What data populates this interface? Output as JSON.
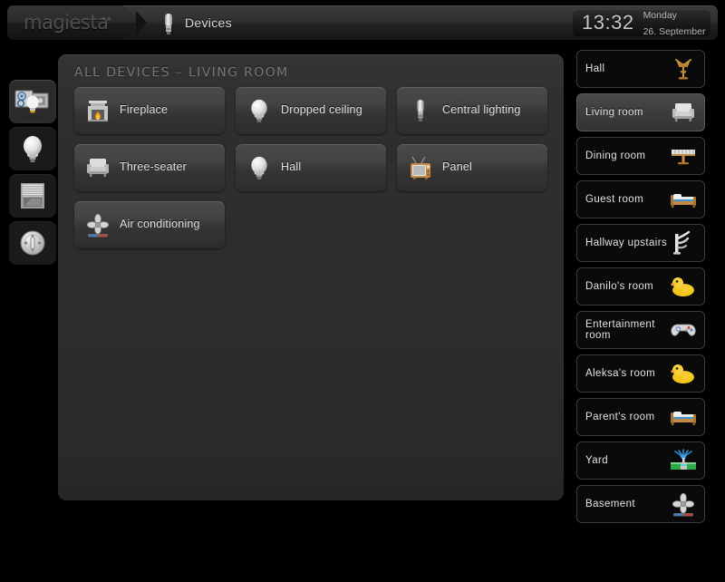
{
  "header": {
    "logo": "magiesta",
    "logo_dots": "••",
    "breadcrumb_icon": "fluorescent-bulb-icon",
    "breadcrumb_title": "Devices",
    "clock": {
      "time": "13:32",
      "day": "Monday",
      "date": "26. September"
    }
  },
  "left_rail": {
    "items": [
      {
        "name": "devices-settings",
        "icon": "devices-settings-icon",
        "active": true
      },
      {
        "name": "lighting",
        "icon": "light-bulb-icon",
        "active": false
      },
      {
        "name": "blinds",
        "icon": "window-blind-icon",
        "active": false
      },
      {
        "name": "outlets",
        "icon": "power-socket-icon",
        "active": false
      }
    ]
  },
  "main": {
    "title": "ALL DEVICES – LIVING ROOM",
    "devices": [
      {
        "label": "Fireplace",
        "icon": "fireplace-icon"
      },
      {
        "label": "Dropped ceiling",
        "icon": "light-bulb-icon"
      },
      {
        "label": "Central lighting",
        "icon": "fluorescent-bulb-icon"
      },
      {
        "label": "Three-seater",
        "icon": "sofa-icon"
      },
      {
        "label": "Hall",
        "icon": "light-bulb-icon"
      },
      {
        "label": "Panel",
        "icon": "tv-icon"
      },
      {
        "label": "Air conditioning",
        "icon": "fan-icon"
      }
    ]
  },
  "rooms": {
    "items": [
      {
        "label": "Hall",
        "icon": "coat-rack-icon",
        "active": false
      },
      {
        "label": "Living room",
        "icon": "sofa-icon",
        "active": true
      },
      {
        "label": "Dining room",
        "icon": "table-icon",
        "active": false
      },
      {
        "label": "Guest room",
        "icon": "bed-icon",
        "active": false
      },
      {
        "label": "Hallway upstairs",
        "icon": "coat-hook-icon",
        "active": false
      },
      {
        "label": "Danilo's room",
        "icon": "rubber-duck-icon",
        "active": false
      },
      {
        "label": "Entertainment room",
        "icon": "gamepad-icon",
        "active": false
      },
      {
        "label": "Aleksa's room",
        "icon": "rubber-duck-icon",
        "active": false
      },
      {
        "label": "Parent's room",
        "icon": "bed-icon",
        "active": false
      },
      {
        "label": "Yard",
        "icon": "sprinkler-icon",
        "active": false
      },
      {
        "label": "Basement",
        "icon": "fan-icon",
        "active": false
      }
    ]
  },
  "colors": {
    "background": "#000000",
    "panel": "#2f2f2f",
    "tile": "#434343",
    "text": "#e2e2e2",
    "muted": "#787878",
    "accent_orange": "#e08a1e",
    "accent_blue": "#2f8fd8"
  }
}
